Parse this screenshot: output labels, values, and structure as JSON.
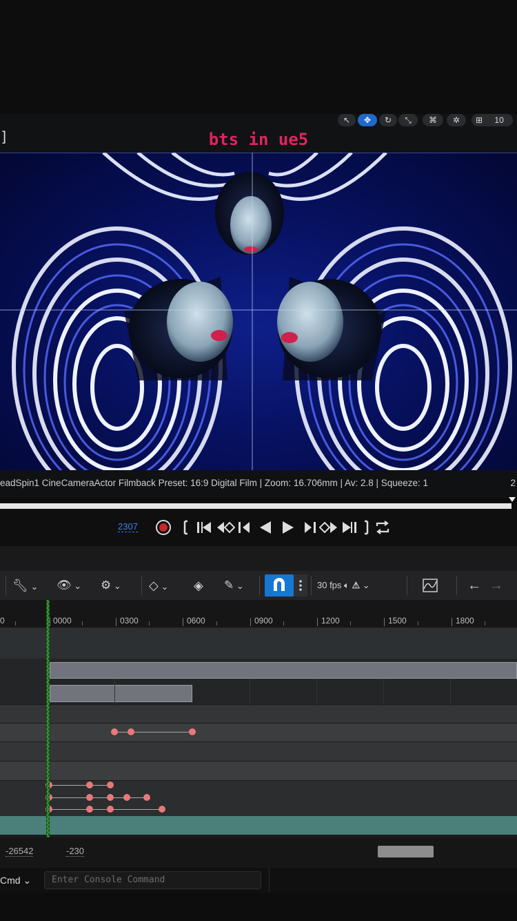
{
  "viewport": {
    "overlay_title": "bts in ue5",
    "bracket": "]",
    "top_toolbar_items": [
      "select",
      "translate",
      "rotate",
      "scale",
      "camera",
      "surface-snap",
      "grid",
      "10"
    ],
    "grid_value": "10"
  },
  "camera_info": {
    "text": "eadSpin1  CineCameraActor  Filmback Preset: 16:9 Digital Film | Zoom: 16.706mm | Av: 2.8 | Squeeze: 1",
    "right_text": "2"
  },
  "transport": {
    "current_frame": "2307"
  },
  "toolbar": {
    "fps_label": "30 fps"
  },
  "ruler": {
    "labels": [
      "0",
      "0000",
      "0300",
      "0600",
      "0900",
      "1200",
      "1500",
      "1800"
    ]
  },
  "bottom": {
    "range_start": "-26542",
    "range_end": "-230",
    "cmd_label": "Cmd",
    "console_placeholder": "Enter Console Command"
  },
  "colors": {
    "accent_blue": "#1677d3",
    "title_pink": "#e0245e",
    "keyframe": "#e9787a",
    "playhead": "#39c239",
    "camera_track": "#4a7f7a"
  }
}
